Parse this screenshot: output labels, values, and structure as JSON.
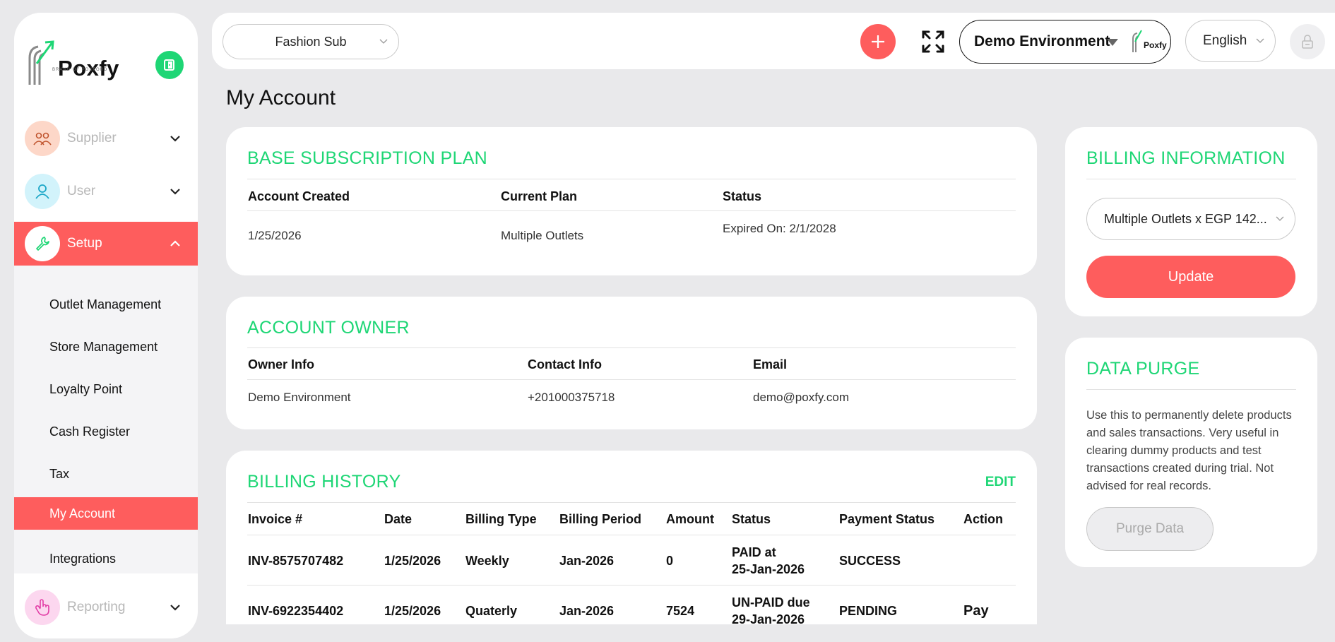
{
  "brand": {
    "name": "Poxfy",
    "tagline": "BRAND OF POXFORD"
  },
  "sidebar": {
    "items": [
      {
        "label": "Supplier"
      },
      {
        "label": "User"
      },
      {
        "label": "Setup"
      },
      {
        "label": "Reporting"
      }
    ],
    "submenu": [
      {
        "label": "Outlet Management"
      },
      {
        "label": "Store Management"
      },
      {
        "label": "Loyalty Point"
      },
      {
        "label": "Cash Register"
      },
      {
        "label": "Tax"
      },
      {
        "label": "My Account"
      },
      {
        "label": "Integrations"
      }
    ]
  },
  "topbar": {
    "outlet": "Fashion Sub",
    "environment": "Demo Environment",
    "mini_logo": "Poxfy",
    "language": "English"
  },
  "page": {
    "title": "My Account"
  },
  "subscription": {
    "title": "BASE SUBSCRIPTION PLAN",
    "headers": [
      "Account Created",
      "Current Plan",
      "Status"
    ],
    "values": [
      "1/25/2026",
      "Multiple Outlets",
      "Expired On: 2/1/2028"
    ]
  },
  "owner": {
    "title": "ACCOUNT OWNER",
    "headers": [
      "Owner Info",
      "Contact Info",
      "Email"
    ],
    "values": [
      "Demo Environment",
      "+201000375718",
      "demo@poxfy.com"
    ]
  },
  "billing_history": {
    "title": "BILLING HISTORY",
    "edit": "EDIT",
    "headers": [
      "Invoice #",
      "Date",
      "Billing Type",
      "Billing Period",
      "Amount",
      "Status",
      "Payment Status",
      "Action"
    ],
    "rows": [
      {
        "invoice": "INV-8575707482",
        "date": "1/25/2026",
        "type": "Weekly",
        "period": "Jan-2026",
        "amount": "0",
        "status1": "PAID at",
        "status2": "25-Jan-2026",
        "payment": "SUCCESS",
        "action": ""
      },
      {
        "invoice": "INV-6922354402",
        "date": "1/25/2026",
        "type": "Quaterly",
        "period": "Jan-2026",
        "amount": "7524",
        "status1": "UN-PAID due",
        "status2": "29-Jan-2026",
        "payment": "PENDING",
        "action": "Pay"
      }
    ]
  },
  "billing_info": {
    "title": "BILLING INFORMATION",
    "selected_plan": "Multiple Outlets x EGP 142...",
    "update": "Update"
  },
  "data_purge": {
    "title": "DATA PURGE",
    "description": "Use this to permanently delete products and sales transactions. Very useful in clearing dummy products and test transactions created during trial. Not advised for real records.",
    "button": "Purge Data"
  },
  "colors": {
    "accent_green": "#1ed675",
    "accent_red": "#fe5d5d",
    "background": "#e9e9eb"
  }
}
